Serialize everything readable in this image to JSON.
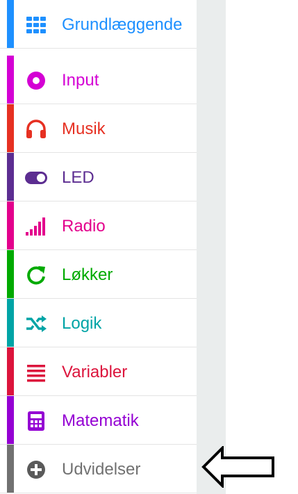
{
  "toolbox": {
    "categories": [
      {
        "label": "Grundlæggende",
        "icon": "grid-icon",
        "color": "#1e90ff"
      },
      {
        "label": "Input",
        "icon": "target-circle-icon",
        "color": "#d400d4"
      },
      {
        "label": "Musik",
        "icon": "headphones-icon",
        "color": "#e63022"
      },
      {
        "label": "LED",
        "icon": "toggle-icon",
        "color": "#5c2d91"
      },
      {
        "label": "Radio",
        "icon": "signal-bars-icon",
        "color": "#e3008c"
      },
      {
        "label": "Løkker",
        "icon": "refresh-icon",
        "color": "#00aa00"
      },
      {
        "label": "Logik",
        "icon": "shuffle-icon",
        "color": "#00a4a6"
      },
      {
        "label": "Variabler",
        "icon": "list-lines-icon",
        "color": "#dc143c"
      },
      {
        "label": "Matematik",
        "icon": "calculator-icon",
        "color": "#9400d3"
      },
      {
        "label": "Udvidelser",
        "icon": "plus-circle-icon",
        "color": "#717171"
      }
    ]
  },
  "annotation": {
    "icon": "arrow-left-icon",
    "color": "#000000"
  }
}
